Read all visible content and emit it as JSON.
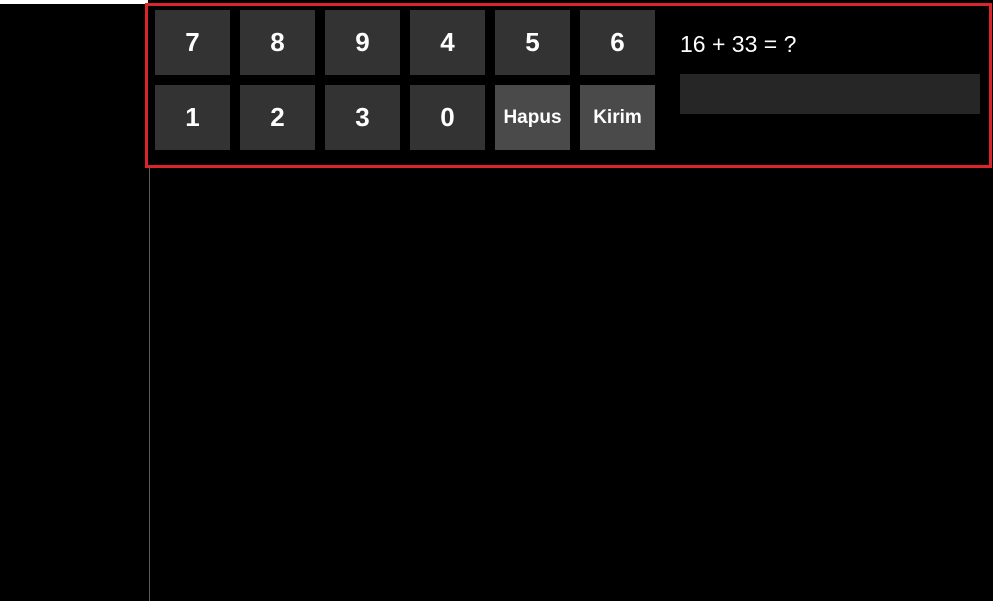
{
  "colors": {
    "background": "#000000",
    "key": "#333333",
    "action_key": "#4a4a4a",
    "answer_field": "#262626",
    "frame_border": "#d9252b",
    "text": "#ffffff"
  },
  "keypad": {
    "row1": [
      "7",
      "8",
      "9",
      "4",
      "5",
      "6"
    ],
    "row2_digits": [
      "1",
      "2",
      "3",
      "0"
    ],
    "delete_label": "Hapus",
    "submit_label": "Kirim"
  },
  "captcha": {
    "question": "16 + 33 = ?",
    "answer_value": ""
  }
}
